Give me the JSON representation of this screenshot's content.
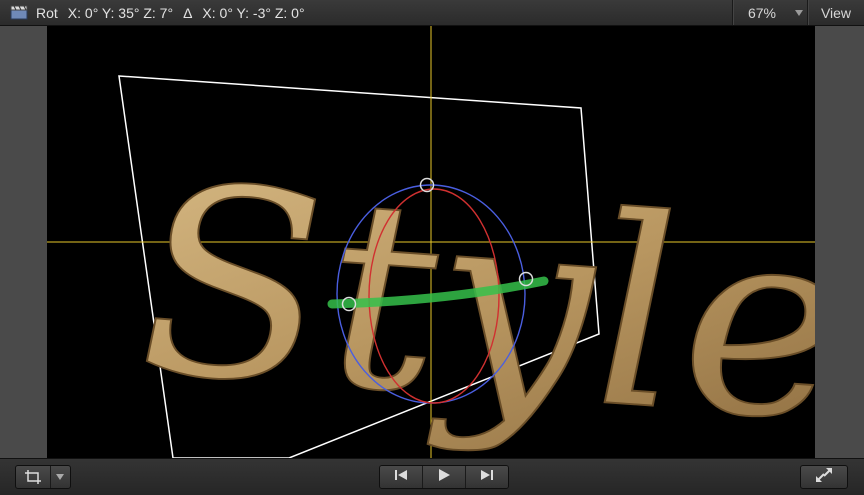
{
  "header": {
    "mode_icon": "clapperboard-icon",
    "rot_label": "Rot",
    "rotation": "X: 0° Y: 35° Z: 7°",
    "delta_symbol": "Δ",
    "delta_rotation": "X: 0° Y: -3° Z: 0°",
    "zoom": "67%",
    "view_label": "View"
  },
  "canvas": {
    "text": "Style",
    "guide_color": "#e8c82a",
    "bounding_box_color": "#ffffff",
    "x_axis_color": "#d03030",
    "y_axis_color": "#4a5ee0",
    "z_axis_color": "#35c04a"
  },
  "footer": {
    "transform_icon": "transform-tool-icon",
    "prev_icon": "go-to-start-icon",
    "play_icon": "play-icon",
    "next_icon": "go-to-end-icon",
    "fullscreen_icon": "fullscreen-icon"
  }
}
